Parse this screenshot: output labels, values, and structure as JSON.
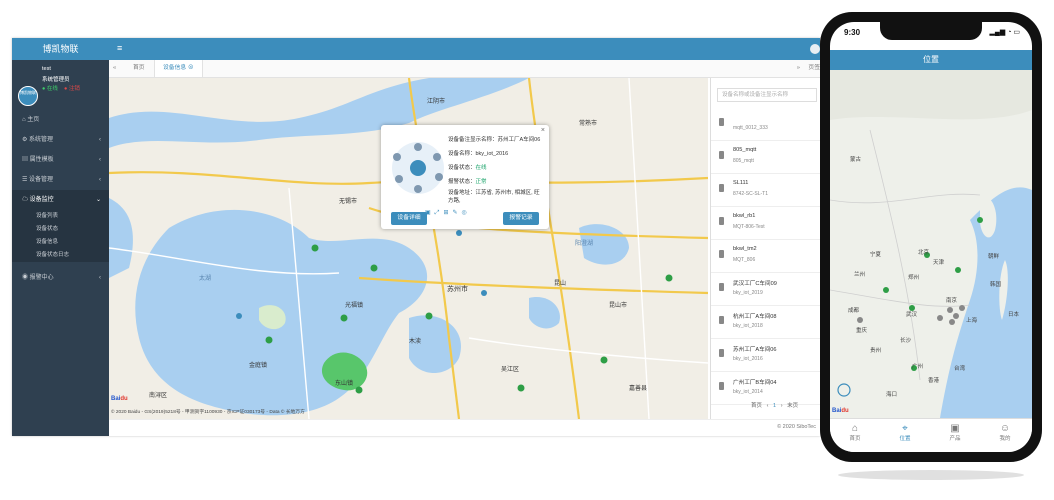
{
  "app": {
    "brand": "博凯物联",
    "user": "test",
    "role": "系统管理员",
    "online": "在线",
    "logout": "注销",
    "avatar_text": "博凯物联"
  },
  "sidebar": {
    "items": [
      {
        "label": "主页"
      },
      {
        "label": "系统管理"
      },
      {
        "label": "属性模板"
      },
      {
        "label": "设备管理"
      },
      {
        "label": "设备监控"
      },
      {
        "label": "报警中心"
      }
    ],
    "sub": [
      "设备列表",
      "设备状态",
      "设备信息",
      "设备状态日志"
    ]
  },
  "tabs": {
    "home": "首页",
    "active": "设备信息",
    "right": "页签"
  },
  "search": {
    "placeholder": "设备名称或设备注显示名称"
  },
  "devices": [
    {
      "name": "",
      "code": "mqtt_0012_333"
    },
    {
      "name": "805_mqtt",
      "code": "805_mqtt"
    },
    {
      "name": "SL111",
      "code": "8742-SC-SL-T1"
    },
    {
      "name": "bkwl_rb1",
      "code": "MQT-806-Test"
    },
    {
      "name": "bkwl_tm2",
      "code": "MQT_806"
    },
    {
      "name": "武汉工厂C车间09",
      "code": "bky_iot_2019"
    },
    {
      "name": "杭州工厂A车间08",
      "code": "bky_iot_2018"
    },
    {
      "name": "苏州工厂A车间06",
      "code": "bky_iot_2016"
    },
    {
      "name": "广州工厂B车间04",
      "code": "bky_iot_2014"
    }
  ],
  "pager": {
    "first": "首页",
    "prev": "‹",
    "page": "1",
    "next": "›",
    "last": "末页"
  },
  "popup": {
    "display_name": "设备备注显示名称：苏州工厂A车间06",
    "name": "设备名称：bky_iot_2016",
    "status_label": "设备状态：",
    "status_value": "在线",
    "alarm_label": "报警状态：",
    "alarm_value": "正常",
    "address": "设备地址：江苏省, 苏州市, 相城区, 旺方路,",
    "btn_detail": "设备详细",
    "btn_alarm": "报警记录"
  },
  "map": {
    "copyright": "© 2020 Baidu - GS(2019)5218号 - 甲测资字1100930 - 京ICP证030173号 - Data © 长地万方",
    "cities": [
      "无锡市",
      "苏州市",
      "吴江区",
      "木渎",
      "光福镇",
      "东山镇",
      "金庭镇",
      "太湖",
      "常熟市",
      "昆山市",
      "江阴市",
      "南浔区",
      "嘉善县",
      "昆山",
      "阳澄湖"
    ]
  },
  "footer": {
    "copy": "© 2020 SiboTec"
  },
  "phone": {
    "time": "9:30",
    "title": "位置",
    "nav": [
      {
        "label": "首页"
      },
      {
        "label": "位置"
      },
      {
        "label": "产品"
      },
      {
        "label": "我的"
      }
    ],
    "cities": [
      "蒙古",
      "北京",
      "天津",
      "朝鲜",
      "韩国",
      "郑州",
      "南京",
      "武汉",
      "上海",
      "成都",
      "重庆",
      "长沙",
      "贵州",
      "广州",
      "香港",
      "海口",
      "台湾",
      "日本",
      "宁夏",
      "兰州"
    ]
  },
  "colors": {
    "accent": "#3c8dbc",
    "sidebar": "#2f4050",
    "online": "#1aa36a",
    "marker": "#2e9e46"
  }
}
